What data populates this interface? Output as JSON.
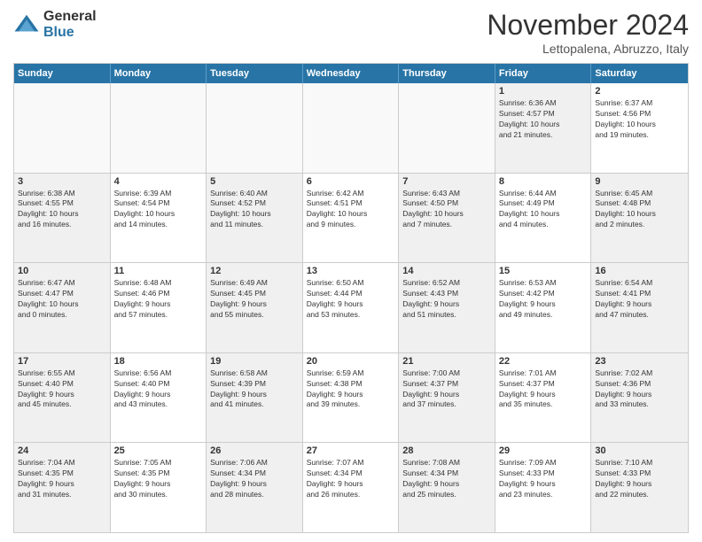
{
  "logo": {
    "general": "General",
    "blue": "Blue"
  },
  "title": "November 2024",
  "location": "Lettopalena, Abruzzo, Italy",
  "weekdays": [
    "Sunday",
    "Monday",
    "Tuesday",
    "Wednesday",
    "Thursday",
    "Friday",
    "Saturday"
  ],
  "rows": [
    [
      {
        "day": "",
        "info": "",
        "shaded": false,
        "empty": true
      },
      {
        "day": "",
        "info": "",
        "shaded": false,
        "empty": true
      },
      {
        "day": "",
        "info": "",
        "shaded": false,
        "empty": true
      },
      {
        "day": "",
        "info": "",
        "shaded": false,
        "empty": true
      },
      {
        "day": "",
        "info": "",
        "shaded": false,
        "empty": true
      },
      {
        "day": "1",
        "info": "Sunrise: 6:36 AM\nSunset: 4:57 PM\nDaylight: 10 hours\nand 21 minutes.",
        "shaded": true,
        "empty": false
      },
      {
        "day": "2",
        "info": "Sunrise: 6:37 AM\nSunset: 4:56 PM\nDaylight: 10 hours\nand 19 minutes.",
        "shaded": false,
        "empty": false
      }
    ],
    [
      {
        "day": "3",
        "info": "Sunrise: 6:38 AM\nSunset: 4:55 PM\nDaylight: 10 hours\nand 16 minutes.",
        "shaded": true,
        "empty": false
      },
      {
        "day": "4",
        "info": "Sunrise: 6:39 AM\nSunset: 4:54 PM\nDaylight: 10 hours\nand 14 minutes.",
        "shaded": false,
        "empty": false
      },
      {
        "day": "5",
        "info": "Sunrise: 6:40 AM\nSunset: 4:52 PM\nDaylight: 10 hours\nand 11 minutes.",
        "shaded": true,
        "empty": false
      },
      {
        "day": "6",
        "info": "Sunrise: 6:42 AM\nSunset: 4:51 PM\nDaylight: 10 hours\nand 9 minutes.",
        "shaded": false,
        "empty": false
      },
      {
        "day": "7",
        "info": "Sunrise: 6:43 AM\nSunset: 4:50 PM\nDaylight: 10 hours\nand 7 minutes.",
        "shaded": true,
        "empty": false
      },
      {
        "day": "8",
        "info": "Sunrise: 6:44 AM\nSunset: 4:49 PM\nDaylight: 10 hours\nand 4 minutes.",
        "shaded": false,
        "empty": false
      },
      {
        "day": "9",
        "info": "Sunrise: 6:45 AM\nSunset: 4:48 PM\nDaylight: 10 hours\nand 2 minutes.",
        "shaded": true,
        "empty": false
      }
    ],
    [
      {
        "day": "10",
        "info": "Sunrise: 6:47 AM\nSunset: 4:47 PM\nDaylight: 10 hours\nand 0 minutes.",
        "shaded": true,
        "empty": false
      },
      {
        "day": "11",
        "info": "Sunrise: 6:48 AM\nSunset: 4:46 PM\nDaylight: 9 hours\nand 57 minutes.",
        "shaded": false,
        "empty": false
      },
      {
        "day": "12",
        "info": "Sunrise: 6:49 AM\nSunset: 4:45 PM\nDaylight: 9 hours\nand 55 minutes.",
        "shaded": true,
        "empty": false
      },
      {
        "day": "13",
        "info": "Sunrise: 6:50 AM\nSunset: 4:44 PM\nDaylight: 9 hours\nand 53 minutes.",
        "shaded": false,
        "empty": false
      },
      {
        "day": "14",
        "info": "Sunrise: 6:52 AM\nSunset: 4:43 PM\nDaylight: 9 hours\nand 51 minutes.",
        "shaded": true,
        "empty": false
      },
      {
        "day": "15",
        "info": "Sunrise: 6:53 AM\nSunset: 4:42 PM\nDaylight: 9 hours\nand 49 minutes.",
        "shaded": false,
        "empty": false
      },
      {
        "day": "16",
        "info": "Sunrise: 6:54 AM\nSunset: 4:41 PM\nDaylight: 9 hours\nand 47 minutes.",
        "shaded": true,
        "empty": false
      }
    ],
    [
      {
        "day": "17",
        "info": "Sunrise: 6:55 AM\nSunset: 4:40 PM\nDaylight: 9 hours\nand 45 minutes.",
        "shaded": true,
        "empty": false
      },
      {
        "day": "18",
        "info": "Sunrise: 6:56 AM\nSunset: 4:40 PM\nDaylight: 9 hours\nand 43 minutes.",
        "shaded": false,
        "empty": false
      },
      {
        "day": "19",
        "info": "Sunrise: 6:58 AM\nSunset: 4:39 PM\nDaylight: 9 hours\nand 41 minutes.",
        "shaded": true,
        "empty": false
      },
      {
        "day": "20",
        "info": "Sunrise: 6:59 AM\nSunset: 4:38 PM\nDaylight: 9 hours\nand 39 minutes.",
        "shaded": false,
        "empty": false
      },
      {
        "day": "21",
        "info": "Sunrise: 7:00 AM\nSunset: 4:37 PM\nDaylight: 9 hours\nand 37 minutes.",
        "shaded": true,
        "empty": false
      },
      {
        "day": "22",
        "info": "Sunrise: 7:01 AM\nSunset: 4:37 PM\nDaylight: 9 hours\nand 35 minutes.",
        "shaded": false,
        "empty": false
      },
      {
        "day": "23",
        "info": "Sunrise: 7:02 AM\nSunset: 4:36 PM\nDaylight: 9 hours\nand 33 minutes.",
        "shaded": true,
        "empty": false
      }
    ],
    [
      {
        "day": "24",
        "info": "Sunrise: 7:04 AM\nSunset: 4:35 PM\nDaylight: 9 hours\nand 31 minutes.",
        "shaded": true,
        "empty": false
      },
      {
        "day": "25",
        "info": "Sunrise: 7:05 AM\nSunset: 4:35 PM\nDaylight: 9 hours\nand 30 minutes.",
        "shaded": false,
        "empty": false
      },
      {
        "day": "26",
        "info": "Sunrise: 7:06 AM\nSunset: 4:34 PM\nDaylight: 9 hours\nand 28 minutes.",
        "shaded": true,
        "empty": false
      },
      {
        "day": "27",
        "info": "Sunrise: 7:07 AM\nSunset: 4:34 PM\nDaylight: 9 hours\nand 26 minutes.",
        "shaded": false,
        "empty": false
      },
      {
        "day": "28",
        "info": "Sunrise: 7:08 AM\nSunset: 4:34 PM\nDaylight: 9 hours\nand 25 minutes.",
        "shaded": true,
        "empty": false
      },
      {
        "day": "29",
        "info": "Sunrise: 7:09 AM\nSunset: 4:33 PM\nDaylight: 9 hours\nand 23 minutes.",
        "shaded": false,
        "empty": false
      },
      {
        "day": "30",
        "info": "Sunrise: 7:10 AM\nSunset: 4:33 PM\nDaylight: 9 hours\nand 22 minutes.",
        "shaded": true,
        "empty": false
      }
    ]
  ]
}
